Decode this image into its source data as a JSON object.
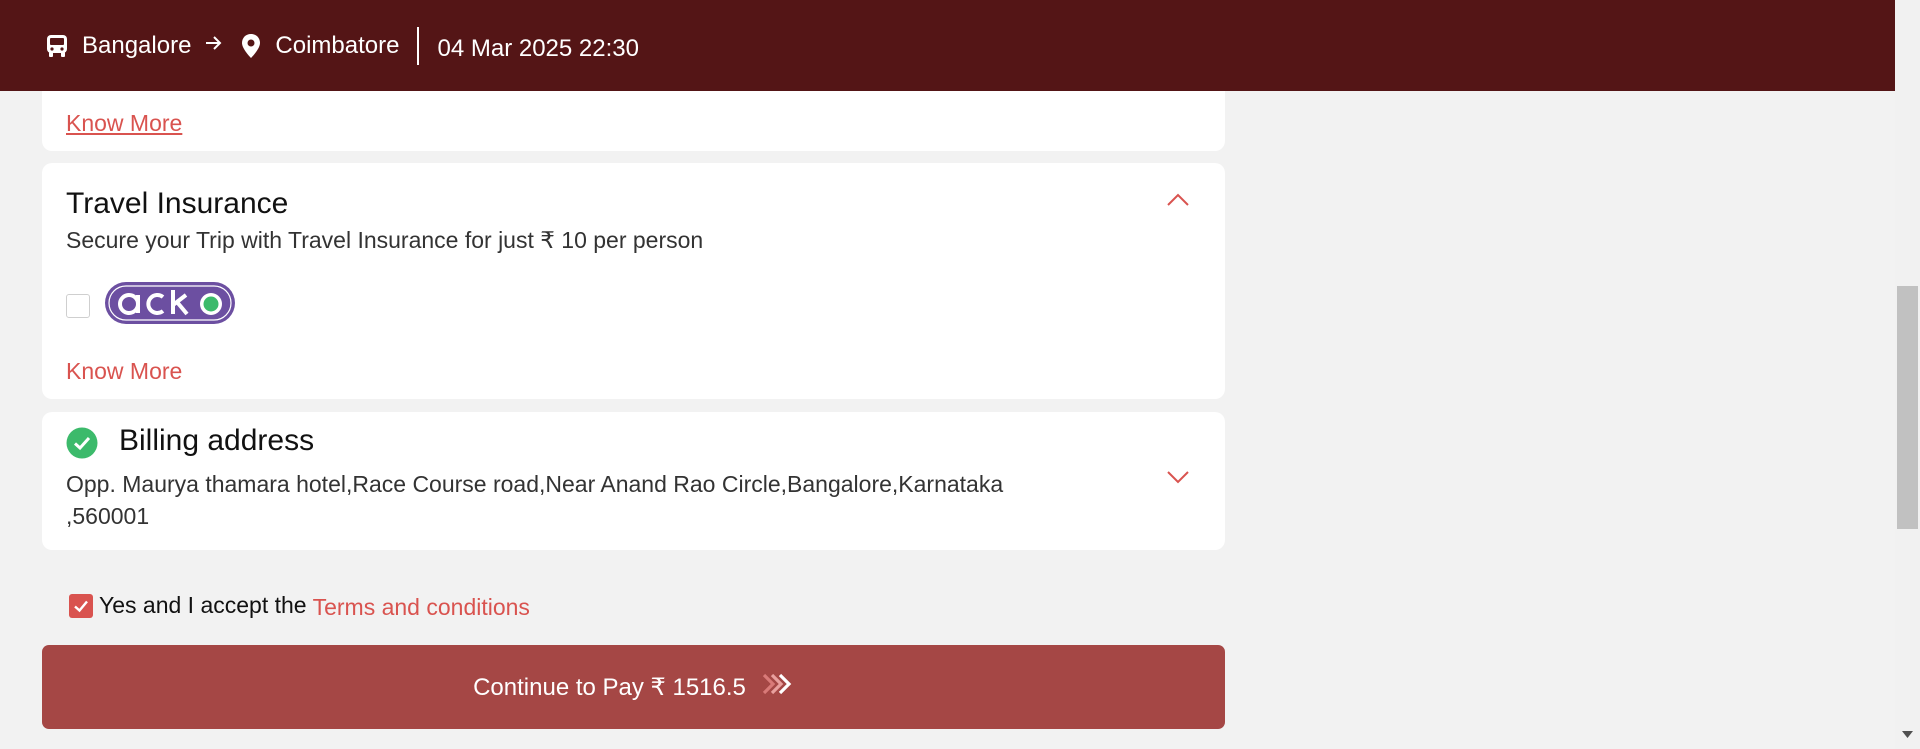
{
  "header": {
    "from": "Bangalore",
    "to": "Coimbatore",
    "datetime": "04 Mar 2025 22:30"
  },
  "top_card": {
    "know_more": "Know More"
  },
  "insurance": {
    "title": "Travel Insurance",
    "subtitle": "Secure your Trip with Travel Insurance for just ₹ 10 per person",
    "provider_logo": "acko",
    "checked": false,
    "know_more": "Know More"
  },
  "billing": {
    "title": "Billing address",
    "address_line1": "Opp. Maurya thamara hotel,Race Course road,Near Anand Rao Circle,Bangalore,Karnataka",
    "address_line2": ",560001"
  },
  "terms": {
    "checked": true,
    "text": "Yes and I accept the",
    "link": "Terms and conditions"
  },
  "pay_button": {
    "label": "Continue to Pay ₹ 1516.5"
  },
  "icons": {
    "bus": "bus-icon",
    "arrow": "arrow-right-icon",
    "pin": "location-pin-icon",
    "chevron_up": "chevron-up-icon",
    "chevron_down": "chevron-down-icon",
    "check_circle": "check-circle-icon",
    "double_chevron": "double-chevron-right-icon"
  },
  "colors": {
    "header_bg": "#541516",
    "accent": "#d9534f",
    "button_bg": "#a54745",
    "success": "#3cba6b",
    "acko_purple": "#6c4fa1"
  }
}
